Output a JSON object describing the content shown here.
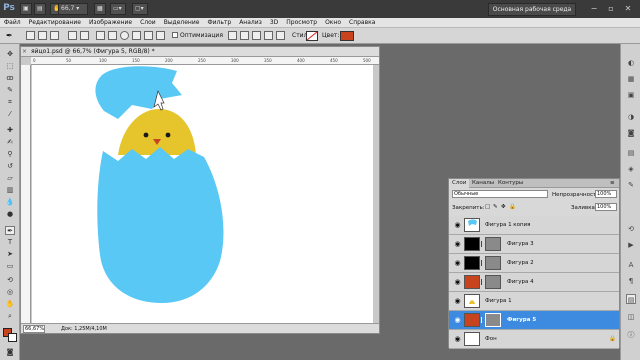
{
  "app": {
    "logo": "Ps",
    "zoom_value": "66,7",
    "workspace": "Основная рабочая среда"
  },
  "menu": [
    "Файл",
    "Редактирование",
    "Изображение",
    "Слои",
    "Выделение",
    "Фильтр",
    "Анализ",
    "3D",
    "Просмотр",
    "Окно",
    "Справка"
  ],
  "options": {
    "autoselect_label": "Оптимизация",
    "style_label": "Стиль:",
    "color_label": "Цвет:",
    "color_value": "#c8441f"
  },
  "document": {
    "tab_title": "яйцо1.psd @ 66,7% (Фигура 5, RGB/8) *",
    "ruler_ticks": [
      "0",
      "50",
      "100",
      "150",
      "200",
      "250",
      "300",
      "350",
      "400",
      "450",
      "500"
    ],
    "zoom": "66,67%",
    "info": "Док: 1,25M/4,10M"
  },
  "colors": {
    "foreground": "#c8441f",
    "background": "#ffffff",
    "egg_shell": "#5ac8f5",
    "chick": "#e5c42c",
    "selection": "#3d8be0"
  },
  "layers_panel": {
    "tabs": [
      "Слои",
      "Каналы",
      "Контуры"
    ],
    "blend_mode": "Обычные",
    "opacity_label": "Непрозрачность:",
    "opacity_value": "100%",
    "lock_label": "Закрепить:",
    "fill_label": "Заливка:",
    "fill_value": "100%",
    "layers": [
      {
        "name": "Фигура 1 копия",
        "thumb": "#ffffff",
        "mask": false,
        "selected": false
      },
      {
        "name": "Фигура 3",
        "thumb": "#000000",
        "mask": true,
        "selected": false
      },
      {
        "name": "Фигура 2",
        "thumb": "#000000",
        "mask": true,
        "selected": false
      },
      {
        "name": "Фигура 4",
        "thumb": "#c8441f",
        "mask": true,
        "selected": false
      },
      {
        "name": "Фигура 1",
        "thumb": "#ffffff",
        "mask": false,
        "selected": false
      },
      {
        "name": "Фигура 5",
        "thumb": "#c8441f",
        "mask": true,
        "selected": true
      },
      {
        "name": "Фон",
        "thumb": "#ffffff",
        "mask": false,
        "selected": false
      }
    ]
  }
}
